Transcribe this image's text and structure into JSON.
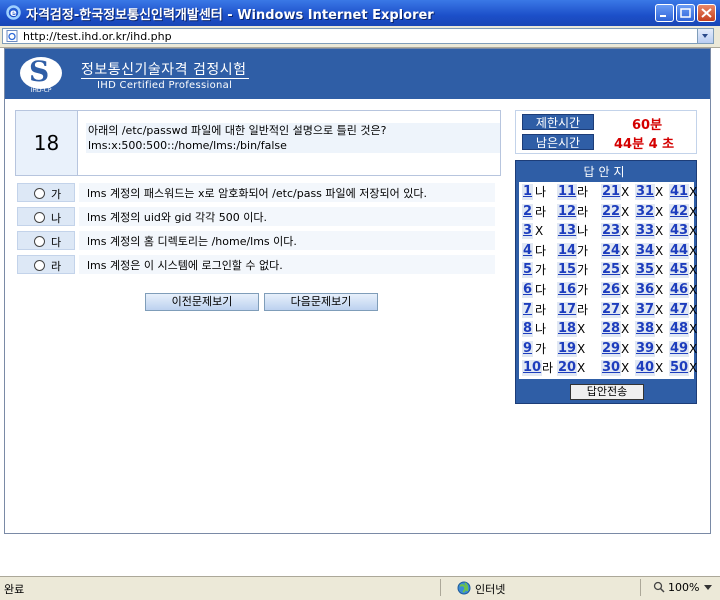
{
  "window": {
    "title": "자격검정-한국정보통신인력개발센터 - Windows Internet Explorer",
    "url": "http://test.ihd.or.kr/ihd.php"
  },
  "banner": {
    "logo_text": "IHD-CP",
    "title": "정보통신기술자격  검정시험",
    "subtitle": "IHD Certified Professional"
  },
  "question": {
    "number": "18",
    "text_line1": "아래의 /etc/passwd 파일에 대한 일반적인 설명으로 틀린 것은?",
    "text_line2": "lms:x:500:500::/home/lms:/bin/false"
  },
  "options": [
    {
      "letter": "가",
      "text": "lms 계정의 패스워드는 x로 암호화되어 /etc/pass 파일에 저장되어 있다."
    },
    {
      "letter": "나",
      "text": "lms 계정의 uid와 gid 각각 500 이다."
    },
    {
      "letter": "다",
      "text": "lms 계정의 홈 디렉토리는 /home/lms 이다."
    },
    {
      "letter": "라",
      "text": "lms 계정은 이 시스템에 로그인할 수 없다."
    }
  ],
  "nav": {
    "prev": "이전문제보기",
    "next": "다음문제보기"
  },
  "time": {
    "limit_label": "제한시간",
    "limit_value": "60분",
    "remain_label": "남은시간",
    "remain_value": "44분 4 초"
  },
  "answer_sheet": {
    "title": "답안지",
    "submit": "답안전송",
    "answers": [
      [
        "나",
        "라",
        "X",
        "X",
        "X"
      ],
      [
        "라",
        "라",
        "X",
        "X",
        "X"
      ],
      [
        "X",
        "나",
        "X",
        "X",
        "X"
      ],
      [
        "다",
        "가",
        "X",
        "X",
        "X"
      ],
      [
        "가",
        "가",
        "X",
        "X",
        "X"
      ],
      [
        "다",
        "가",
        "X",
        "X",
        "X"
      ],
      [
        "라",
        "라",
        "X",
        "X",
        "X"
      ],
      [
        "나",
        "X",
        "X",
        "X",
        "X"
      ],
      [
        "가",
        "X",
        "X",
        "X",
        "X"
      ],
      [
        "라",
        "X",
        "X",
        "X",
        "X"
      ]
    ]
  },
  "status": {
    "left": "완료",
    "zone": "인터넷",
    "zoom": "100%"
  }
}
